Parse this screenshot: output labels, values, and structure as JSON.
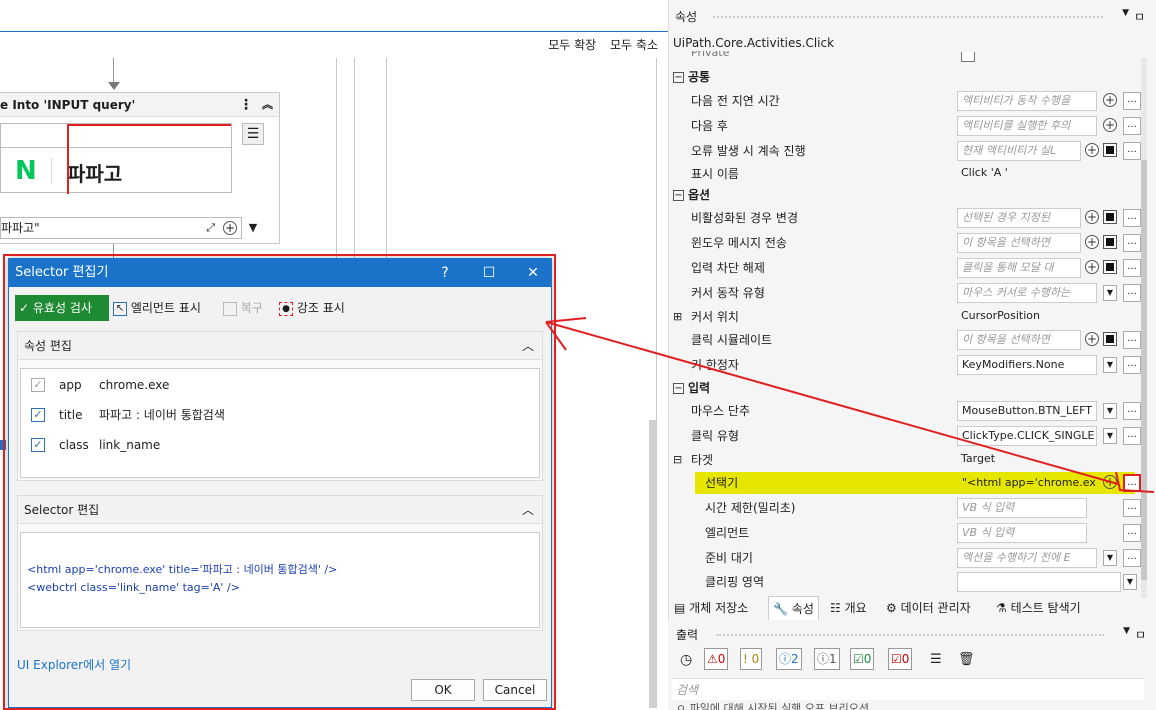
{
  "designer": {
    "expand_all": "모두 확장",
    "collapse_all": "모두 축소",
    "activity_title": "e Into 'INPUT  query'",
    "naver_logo": "N",
    "preview_text": "파파고",
    "selector_value": "파파고\""
  },
  "dialog": {
    "title": "Selector 편집기",
    "help": "?",
    "maximize": "☐",
    "close": "✕",
    "validate": "유효성 검사",
    "show_element": "엘리먼트 표시",
    "repair": "복구",
    "highlight": "강조 표시",
    "attr_section": "속성 편집",
    "attributes": [
      {
        "name": "app",
        "value": "chrome.exe",
        "checked": true,
        "disabled": true
      },
      {
        "name": "title",
        "value": "파파고 : 네이버 통합검색",
        "checked": true,
        "disabled": false
      },
      {
        "name": "class",
        "value": "link_name",
        "checked": true,
        "disabled": false
      }
    ],
    "selector_section": "Selector 편집",
    "selector_line1": "<html app='chrome.exe' title='파파고 : 네이버 통합검색' />",
    "selector_line2": "<webctrl class='link_name' tag='A' />",
    "ui_explorer": "UI Explorer에서 열기",
    "ok": "OK",
    "cancel": "Cancel"
  },
  "properties": {
    "header": "속성",
    "pin": "ㅁ",
    "activity_name": "UiPath.Core.Activities.Click",
    "private_label": "Private",
    "sections": {
      "common": "공통",
      "options": "옵션",
      "input": "입력",
      "target": "타겟"
    },
    "rows": [
      {
        "name": "다음 전 지연 시간",
        "value": "액티비티가 동작 수행을"
      },
      {
        "name": "다음 후",
        "value": "액티비티를 실행한 후의"
      },
      {
        "name": "오류 발생 시 계속 진행",
        "value": "현재 액티비티가 실L"
      },
      {
        "name": "표시 이름",
        "value": "Click 'A '"
      },
      {
        "name": "비활성화된 경우 변경",
        "value": "선택된 경우 지정된"
      },
      {
        "name": "윈도우 메시지 전송",
        "value": "이 항목을 선택하면"
      },
      {
        "name": "입력 차단 해제",
        "value": "클릭을 통해 모달 대"
      },
      {
        "name": "커서 동작 유형",
        "value": "마우스 커서로 수행하는"
      },
      {
        "name": "커서 위치",
        "value": "CursorPosition"
      },
      {
        "name": "클릭 시뮬레이트",
        "value": "이 항목을 선택하면"
      },
      {
        "name": "키 한정자",
        "value": "KeyModifiers.None"
      },
      {
        "name": "마우스 단추",
        "value": "MouseButton.BTN_LEFT"
      },
      {
        "name": "클릭 유형",
        "value": "ClickType.CLICK_SINGLE"
      },
      {
        "name": "타겟",
        "value": "Target"
      },
      {
        "name": "선택기",
        "value": "\"<html app='chrome.ex"
      },
      {
        "name": "시간 제한(밀리초)",
        "value": "VB 식 입력"
      },
      {
        "name": "엘리먼트",
        "value": "VB 식 입력"
      },
      {
        "name": "준비 대기",
        "value": "액션을 수행하기 전에 E"
      },
      {
        "name": "클리핑 영역",
        "value": ""
      }
    ]
  },
  "bottom_tabs": [
    "개체 저장소",
    "속성",
    "개요",
    "데이터 관리자",
    "테스트 탐색기"
  ],
  "output": {
    "header": "출력",
    "counts": [
      "0",
      "0",
      "2",
      "1",
      "0",
      "0"
    ],
    "search_placeholder": "검색",
    "partial_line": "ㅇ 파일에 대해 시작된 실행 오프 브리오션"
  },
  "colors": {
    "accent": "#1a73c9",
    "validate_green": "#1e8a32",
    "highlight_yellow": "#e6e600",
    "annotation_red": "#e02020",
    "naver_green": "#03c75a"
  }
}
